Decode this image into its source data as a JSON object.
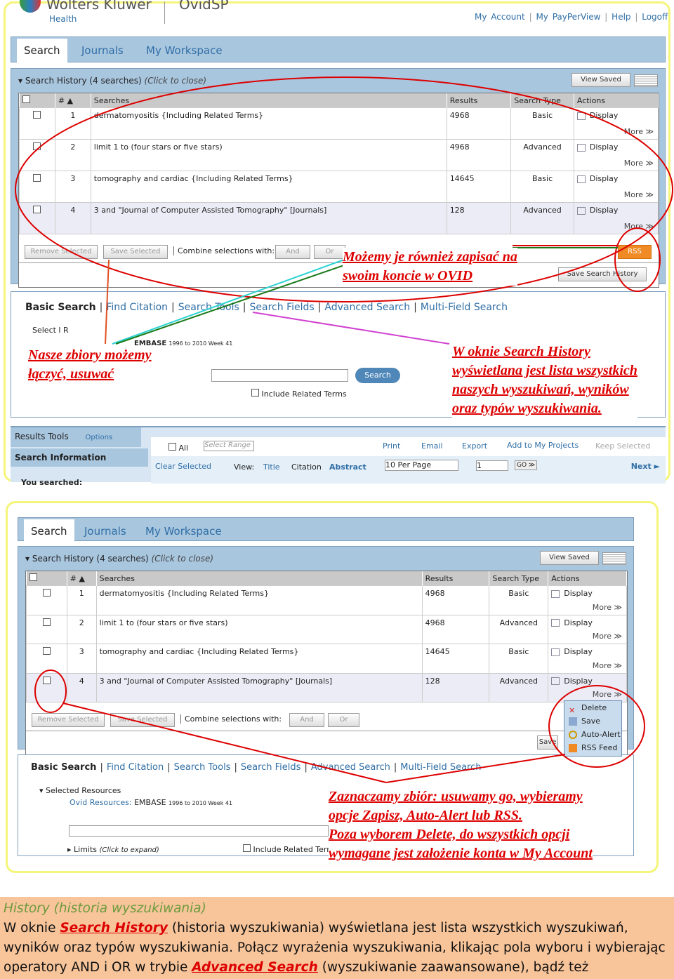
{
  "header": {
    "brand": "Wolters Kluwer",
    "brand_sub": "Health",
    "product": "OvidSP",
    "links": [
      "My Account",
      "My PayPerView",
      "Help",
      "Logoff"
    ]
  },
  "tabs": [
    "Search",
    "Journals",
    "My Workspace"
  ],
  "history": {
    "title": "Search History",
    "count": "(4 searches)",
    "hint": "(Click to close)",
    "view_saved": "View Saved",
    "columns": [
      "",
      "# ▲",
      "Searches",
      "Results",
      "Search Type",
      "Actions"
    ],
    "rows": [
      {
        "num": "1",
        "query": "dermatomyositis {Including Related Terms}",
        "results": "4968",
        "type": "Basic"
      },
      {
        "num": "2",
        "query": "limit 1 to (four stars or five stars)",
        "results": "4968",
        "type": "Advanced"
      },
      {
        "num": "3",
        "query": "tomography and cardiac {Including Related Terms}",
        "results": "14645",
        "type": "Basic"
      },
      {
        "num": "4",
        "query": "3 and \"Journal of Computer Assisted Tomography\" [Journals]",
        "results": "128",
        "type": "Advanced"
      }
    ],
    "display": "Display",
    "more": "More ≫",
    "remove_selected": "Remove Selected",
    "save_selected": "Save Selected",
    "combine_label": "Combine selections with:",
    "and": "And",
    "or": "Or",
    "rss": "RSS",
    "save_history": "Save Search History",
    "save_short": "Save"
  },
  "search": {
    "tabs": [
      "Basic Search",
      "Find Citation",
      "Search Tools",
      "Search Fields",
      "Advanced Search",
      "Multi-Field Search"
    ],
    "selected_resources": "Selected Resources",
    "select_short": "Select  l R",
    "ovid_resources": "Ovid Resources:",
    "db": "EMBASE",
    "db_range": "1996 to 2010 Week 41",
    "search_btn": "Search",
    "include_related": "Include Related Terms",
    "limits": "Limits",
    "limits_hint": "(Click to expand)"
  },
  "results": {
    "tools": "Results Tools",
    "options": "Options",
    "search_info": "Search Information",
    "you_searched": "You searched:",
    "all": "All",
    "select_range": "Select Range",
    "print": "Print",
    "email": "Email",
    "export": "Export",
    "add_projects": "Add to My Projects",
    "keep": "Keep Selected",
    "clear": "Clear Selected",
    "view": "View:",
    "title": "Title",
    "citation": "Citation",
    "abstract": "Abstract",
    "per_page": "10 Per Page",
    "page": "1",
    "go": "GO ≫",
    "next": "Next ►"
  },
  "menu": [
    "Delete",
    "Save",
    "Auto-Alert",
    "RSS Feed"
  ],
  "annotations": {
    "a1": [
      "Możemy je również zapisać na",
      "swoim koncie w OVID"
    ],
    "a2": [
      "Nasze zbiory możemy",
      "łączyć, usuwać"
    ],
    "a3": [
      "W oknie Search History",
      "wyświetlana jest lista wszystkich",
      "naszych wyszukiwań, wyników",
      "oraz typów wyszukiwania."
    ],
    "a4": [
      "Zaznaczamy zbiór: usuwamy go, wybieramy",
      "opcje Zapisz, Auto-Alert lub RSS.",
      "Poza wyborem Delete, do wszystkich opcji",
      "wymagane jest założenie konta w My Account"
    ]
  },
  "footer": {
    "heading": "History (historia wyszukiwania)",
    "p1": "W oknie ",
    "link1": "Search History",
    "p2": " (historia wyszukiwania) wyświetlana jest lista wszystkich wyszukiwań, wyników oraz typów wyszukiwania. Połącz wyrażenia wyszukiwania, klikając pola wyboru i wybierając operatory AND i OR w trybie ",
    "link2": "Advanced Search",
    "p3": " (wyszukiwanie zaawansowane), bądź też"
  },
  "colors": {
    "annotation": "#dd0000",
    "panel": "#a9c6df",
    "link": "#2f6ea5",
    "footer_bg": "#f8c59b"
  }
}
